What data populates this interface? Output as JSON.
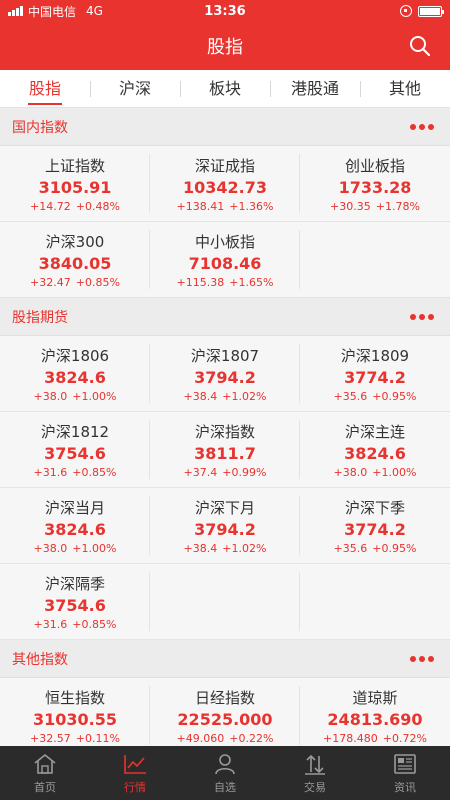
{
  "status": {
    "carrier": "中国电信",
    "network": "4G",
    "time": "13:36"
  },
  "nav": {
    "title": "股指"
  },
  "tabs": [
    "股指",
    "沪深",
    "板块",
    "港股通",
    "其他"
  ],
  "sections": [
    {
      "title": "国内指数",
      "items": [
        {
          "name": "上证指数",
          "price": "3105.91",
          "change": "+14.72",
          "pct": "+0.48%"
        },
        {
          "name": "深证成指",
          "price": "10342.73",
          "change": "+138.41",
          "pct": "+1.36%"
        },
        {
          "name": "创业板指",
          "price": "1733.28",
          "change": "+30.35",
          "pct": "+1.78%"
        },
        {
          "name": "沪深300",
          "price": "3840.05",
          "change": "+32.47",
          "pct": "+0.85%"
        },
        {
          "name": "中小板指",
          "price": "7108.46",
          "change": "+115.38",
          "pct": "+1.65%"
        }
      ]
    },
    {
      "title": "股指期货",
      "items": [
        {
          "name": "沪深1806",
          "price": "3824.6",
          "change": "+38.0",
          "pct": "+1.00%"
        },
        {
          "name": "沪深1807",
          "price": "3794.2",
          "change": "+38.4",
          "pct": "+1.02%"
        },
        {
          "name": "沪深1809",
          "price": "3774.2",
          "change": "+35.6",
          "pct": "+0.95%"
        },
        {
          "name": "沪深1812",
          "price": "3754.6",
          "change": "+31.6",
          "pct": "+0.85%"
        },
        {
          "name": "沪深指数",
          "price": "3811.7",
          "change": "+37.4",
          "pct": "+0.99%"
        },
        {
          "name": "沪深主连",
          "price": "3824.6",
          "change": "+38.0",
          "pct": "+1.00%"
        },
        {
          "name": "沪深当月",
          "price": "3824.6",
          "change": "+38.0",
          "pct": "+1.00%"
        },
        {
          "name": "沪深下月",
          "price": "3794.2",
          "change": "+38.4",
          "pct": "+1.02%"
        },
        {
          "name": "沪深下季",
          "price": "3774.2",
          "change": "+35.6",
          "pct": "+0.95%"
        },
        {
          "name": "沪深隔季",
          "price": "3754.6",
          "change": "+31.6",
          "pct": "+0.85%"
        }
      ]
    },
    {
      "title": "其他指数",
      "items": [
        {
          "name": "恒生指数",
          "price": "31030.55",
          "change": "+32.57",
          "pct": "+0.11%"
        },
        {
          "name": "日经指数",
          "price": "22525.000",
          "change": "+49.060",
          "pct": "+0.22%"
        },
        {
          "name": "道琼斯",
          "price": "24813.690",
          "change": "+178.480",
          "pct": "+0.72%"
        }
      ]
    }
  ],
  "bottom_nav": [
    {
      "label": "首页",
      "icon": "home-icon"
    },
    {
      "label": "行情",
      "icon": "chart-icon"
    },
    {
      "label": "自选",
      "icon": "user-icon"
    },
    {
      "label": "交易",
      "icon": "trade-icon"
    },
    {
      "label": "资讯",
      "icon": "news-icon"
    }
  ],
  "colors": {
    "accent": "#e8332f",
    "up": "#e8332f",
    "bottom_bar": "#2b2b2b"
  }
}
